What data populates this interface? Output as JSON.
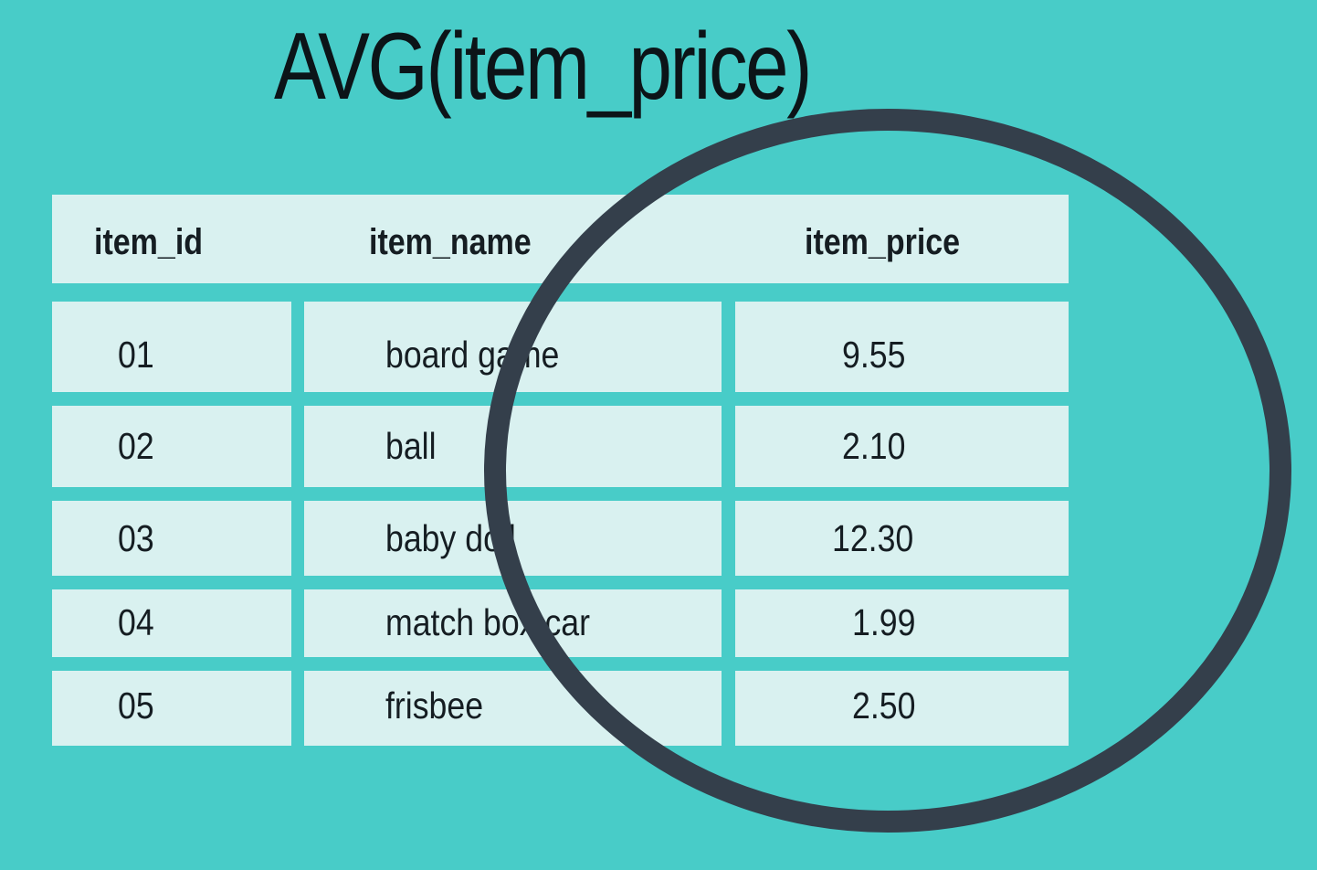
{
  "title": "AVG(item_price)",
  "colors": {
    "background": "#48CCC8",
    "cell": "#D9F1F0",
    "text": "#151d22",
    "ring": "#343F4B"
  },
  "table": {
    "headers": {
      "item_id": "item_id",
      "item_name": "item_name",
      "item_price": "item_price"
    },
    "rows": [
      {
        "item_id": "01",
        "item_name": "board game",
        "item_price": "9.55"
      },
      {
        "item_id": "02",
        "item_name": "ball",
        "item_price": "2.10"
      },
      {
        "item_id": "03",
        "item_name": "baby doll",
        "item_price": "12.30"
      },
      {
        "item_id": "04",
        "item_name": "match box car",
        "item_price": "1.99"
      },
      {
        "item_id": "05",
        "item_name": "frisbee",
        "item_price": "2.50"
      }
    ]
  },
  "highlight": "circle-around-item-price-column"
}
